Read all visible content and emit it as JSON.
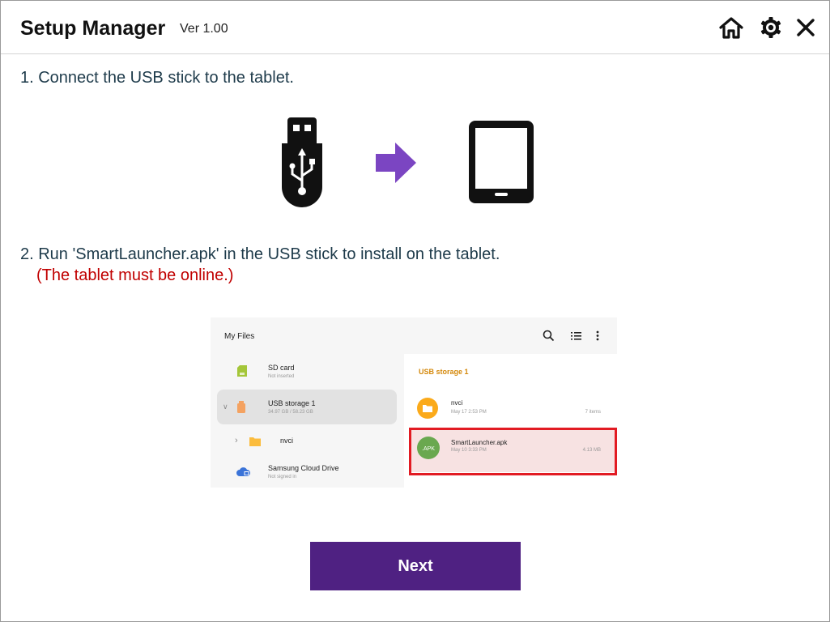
{
  "window": {
    "title": "Setup Manager",
    "version": "Ver 1.00",
    "buttons": [
      "home-icon",
      "gear-icon",
      "close-icon"
    ]
  },
  "steps": {
    "step1": "1. Connect the USB stick to the tablet.",
    "step2": "2. Run 'SmartLauncher.apk' in the USB stick to install on the tablet.",
    "step2_note": "(The tablet must be online.)"
  },
  "illustration": {
    "icons": [
      "usb-stick-icon",
      "arrow-right-icon",
      "tablet-icon"
    ],
    "arrow_color": "#7b45c2"
  },
  "file_manager": {
    "title": "My Files",
    "header_icons": [
      "search-icon",
      "list-view-icon",
      "more-options-icon"
    ],
    "locations": [
      {
        "name": "SD card",
        "detail": "Not inserted"
      },
      {
        "name": "USB storage 1",
        "detail": "34.97 GB / 58.23 GB"
      },
      {
        "name": "nvci",
        "detail": ""
      },
      {
        "name": "Samsung Cloud Drive",
        "detail": "Not signed in"
      }
    ],
    "section_title": "USB storage 1",
    "files": [
      {
        "name": "nvci",
        "date": "May 17 2:53 PM",
        "meta": "7 items",
        "icon": "folder-icon"
      },
      {
        "name": "SmartLauncher.apk",
        "date": "May 10 3:33 PM",
        "meta": "4.13 MB",
        "icon": "apk-icon",
        "badge": ".APK"
      }
    ],
    "highlight_color": "#e21b23"
  },
  "actions": {
    "next_label": "Next",
    "accent": "#4f2182"
  }
}
